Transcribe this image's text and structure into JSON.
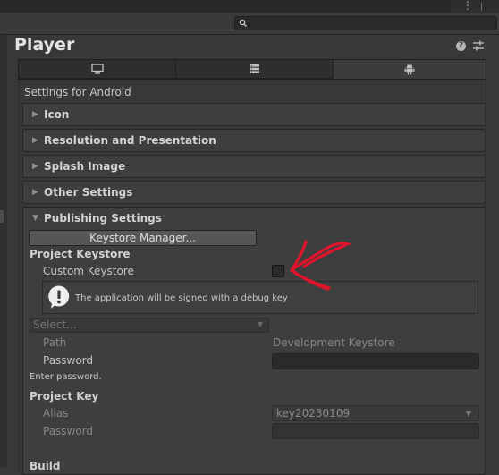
{
  "header": {
    "title": "Player"
  },
  "icons": {
    "more": "kebab-icon",
    "search": "search-icon",
    "help": "help-icon",
    "presets": "presets-icon",
    "standalone": "monitor-icon",
    "server": "server-icon",
    "android": "android-icon",
    "warning": "warning-icon"
  },
  "tabs": {
    "active": "android"
  },
  "inspector": {
    "settings_for": "Settings for Android"
  },
  "sections": {
    "icon": "Icon",
    "resolution": "Resolution and Presentation",
    "splash": "Splash Image",
    "other": "Other Settings",
    "publishing": "Publishing Settings"
  },
  "publishing": {
    "keystore_manager_button": "Keystore Manager...",
    "project_keystore_label": "Project Keystore",
    "custom_keystore_label": "Custom Keystore",
    "custom_keystore_checked": false,
    "help_message": "The application will be signed with a debug key",
    "keystore_select_value": "Select...",
    "path_label": "Path",
    "path_value": "Development Keystore",
    "password_label": "Password",
    "enter_password_hint": "Enter password.",
    "project_key_label": "Project Key",
    "alias_label": "Alias",
    "alias_value": "key20230109",
    "key_password_label": "Password",
    "build_label": "Build"
  },
  "annotation": {
    "color": "#e0142a",
    "shape": "red-arrow-pointing-left"
  }
}
